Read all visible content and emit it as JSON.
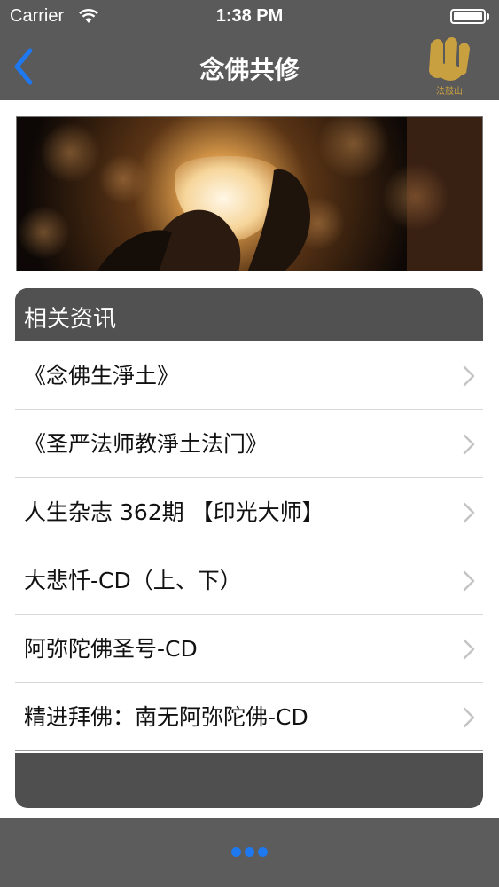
{
  "status_bar": {
    "carrier": "Carrier",
    "time": "1:38 PM"
  },
  "nav": {
    "title": "念佛共修",
    "back_icon": "chevron-left-icon",
    "logo_text": "法鼓山"
  },
  "section": {
    "title": "相关资讯"
  },
  "items": [
    {
      "label": "《念佛生淨土》"
    },
    {
      "label": "《圣严法师教淨土法门》"
    },
    {
      "label": "人生杂志 362期 【印光大师】"
    },
    {
      "label": "大悲忏-CD（上、下）"
    },
    {
      "label": "阿弥陀佛圣号-CD"
    },
    {
      "label": "精进拜佛：南无阿弥陀佛-CD"
    }
  ],
  "bottom_bar": {
    "more_icon": "more-dots-icon"
  },
  "colors": {
    "nav_bg": "#5a5a5a",
    "accent": "#1e78f0",
    "logo_gold": "#c8a040"
  }
}
